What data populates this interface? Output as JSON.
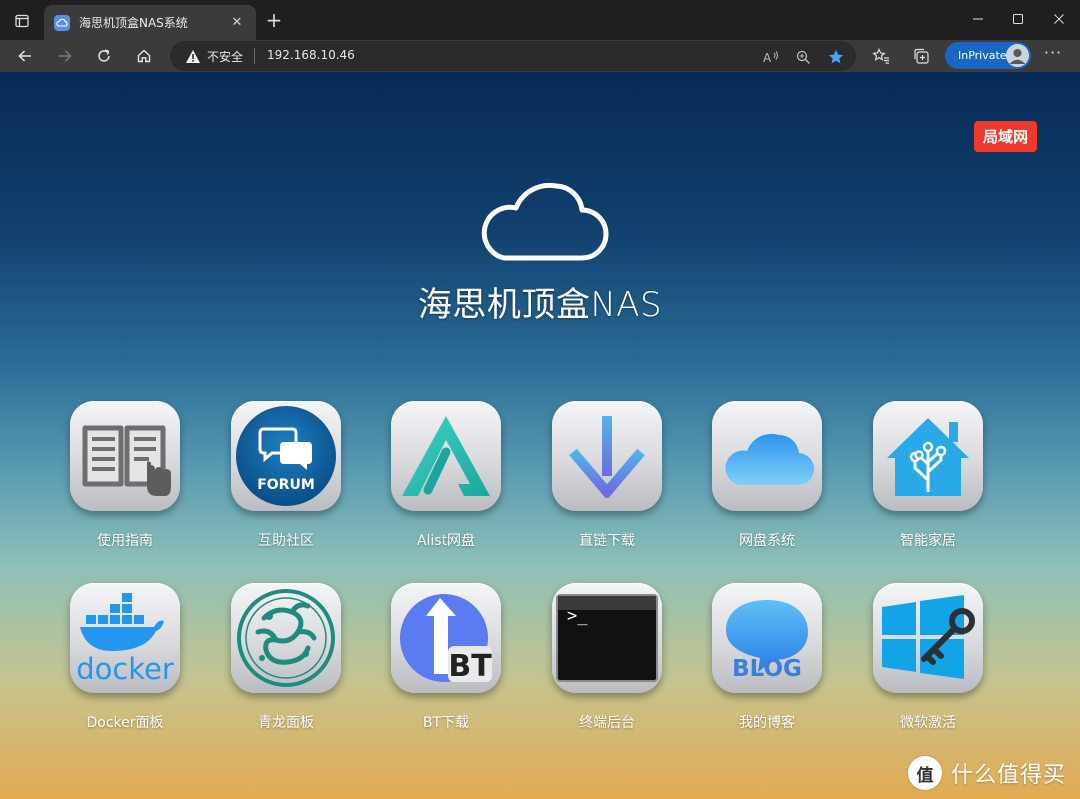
{
  "browser": {
    "tab": {
      "title": "海思机顶盒NAS系统",
      "close_icon": "close-icon"
    },
    "new_tab_label": "+",
    "window_controls": [
      "minimize-icon",
      "maximize-icon",
      "close-icon"
    ],
    "address": {
      "security_label": "不安全",
      "url": "192.168.10.46"
    },
    "inprivate_label": "InPrivate",
    "more_label": "···"
  },
  "page": {
    "badge": "局域网",
    "hero_title": "海思机顶盒NAS",
    "apps": [
      {
        "label": "使用指南",
        "icon": "book-icon"
      },
      {
        "label": "互助社区",
        "icon": "forum-icon",
        "icon_text": "FORUM"
      },
      {
        "label": "Alist网盘",
        "icon": "alist-icon"
      },
      {
        "label": "直链下载",
        "icon": "download-arrow-icon"
      },
      {
        "label": "网盘系统",
        "icon": "cloud-icon"
      },
      {
        "label": "智能家居",
        "icon": "home-assistant-icon"
      },
      {
        "label": "Docker面板",
        "icon": "docker-icon",
        "icon_text": "docker"
      },
      {
        "label": "青龙面板",
        "icon": "dragon-icon"
      },
      {
        "label": "BT下载",
        "icon": "bt-icon",
        "icon_text": "BT"
      },
      {
        "label": "终端后台",
        "icon": "terminal-icon",
        "icon_text": ">_"
      },
      {
        "label": "我的博客",
        "icon": "blog-icon",
        "icon_text": "BLOG"
      },
      {
        "label": "微软激活",
        "icon": "windows-key-icon"
      }
    ]
  },
  "watermark": {
    "symbol": "值",
    "text": "什么值得买"
  },
  "colors": {
    "badge": "#ee3a2c",
    "inprivate": "#1867c6",
    "favorite_star": "#4aa3ff"
  }
}
